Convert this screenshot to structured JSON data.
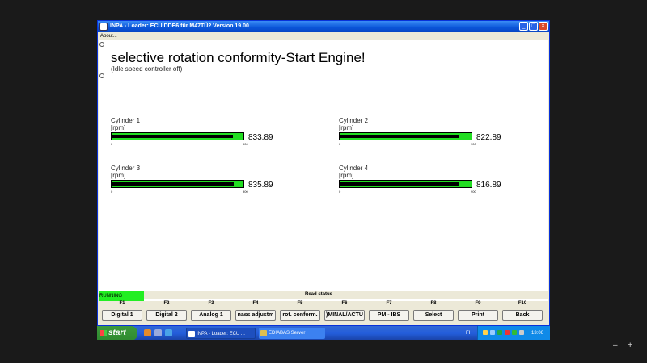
{
  "window": {
    "title": "INPA - Loader:  ECU DDE6 für M47TÜ2 Version 19.00",
    "menu": [
      "About..."
    ]
  },
  "page": {
    "title": "selective rotation conformity-Start Engine!",
    "subtitle": "(Idle speed controller off)"
  },
  "gauges": [
    {
      "name": "Cylinder 1",
      "unit": "[rpm]",
      "min": "0",
      "max": "900",
      "value_text": "833.89",
      "fraction": 0.927
    },
    {
      "name": "Cylinder 2",
      "unit": "[rpm]",
      "min": "0",
      "max": "900",
      "value_text": "822.89",
      "fraction": 0.914
    },
    {
      "name": "Cylinder 3",
      "unit": "[rpm]",
      "min": "0",
      "max": "900",
      "value_text": "835.89",
      "fraction": 0.929
    },
    {
      "name": "Cylinder 4",
      "unit": "[rpm]",
      "min": "0",
      "max": "900",
      "value_text": "816.89",
      "fraction": 0.908
    }
  ],
  "colors": {
    "bar_green": "#22dd22",
    "running_green": "#22ee22"
  },
  "status": {
    "running": "RUNNING",
    "read_status": "Read status"
  },
  "fkeys": [
    {
      "key": "F1",
      "label": "Digital 1"
    },
    {
      "key": "F2",
      "label": "Digital 2"
    },
    {
      "key": "F3",
      "label": "Analog 1"
    },
    {
      "key": "F4",
      "label": "nass adjustm"
    },
    {
      "key": "F5",
      "label": "rot. conform."
    },
    {
      "key": "F6",
      "label": ")MINAL/ACTU"
    },
    {
      "key": "F7",
      "label": "PM - IBS"
    },
    {
      "key": "F8",
      "label": "Select"
    },
    {
      "key": "F9",
      "label": "Print"
    },
    {
      "key": "F10",
      "label": "Back"
    }
  ],
  "taskbar": {
    "start": "start",
    "tasks": [
      "INPA - Loader:  ECU ...",
      "EDIABAS Server"
    ],
    "lang": "FI",
    "clock": "13:06"
  },
  "zoom": {
    "minus": "–",
    "plus": "+"
  }
}
